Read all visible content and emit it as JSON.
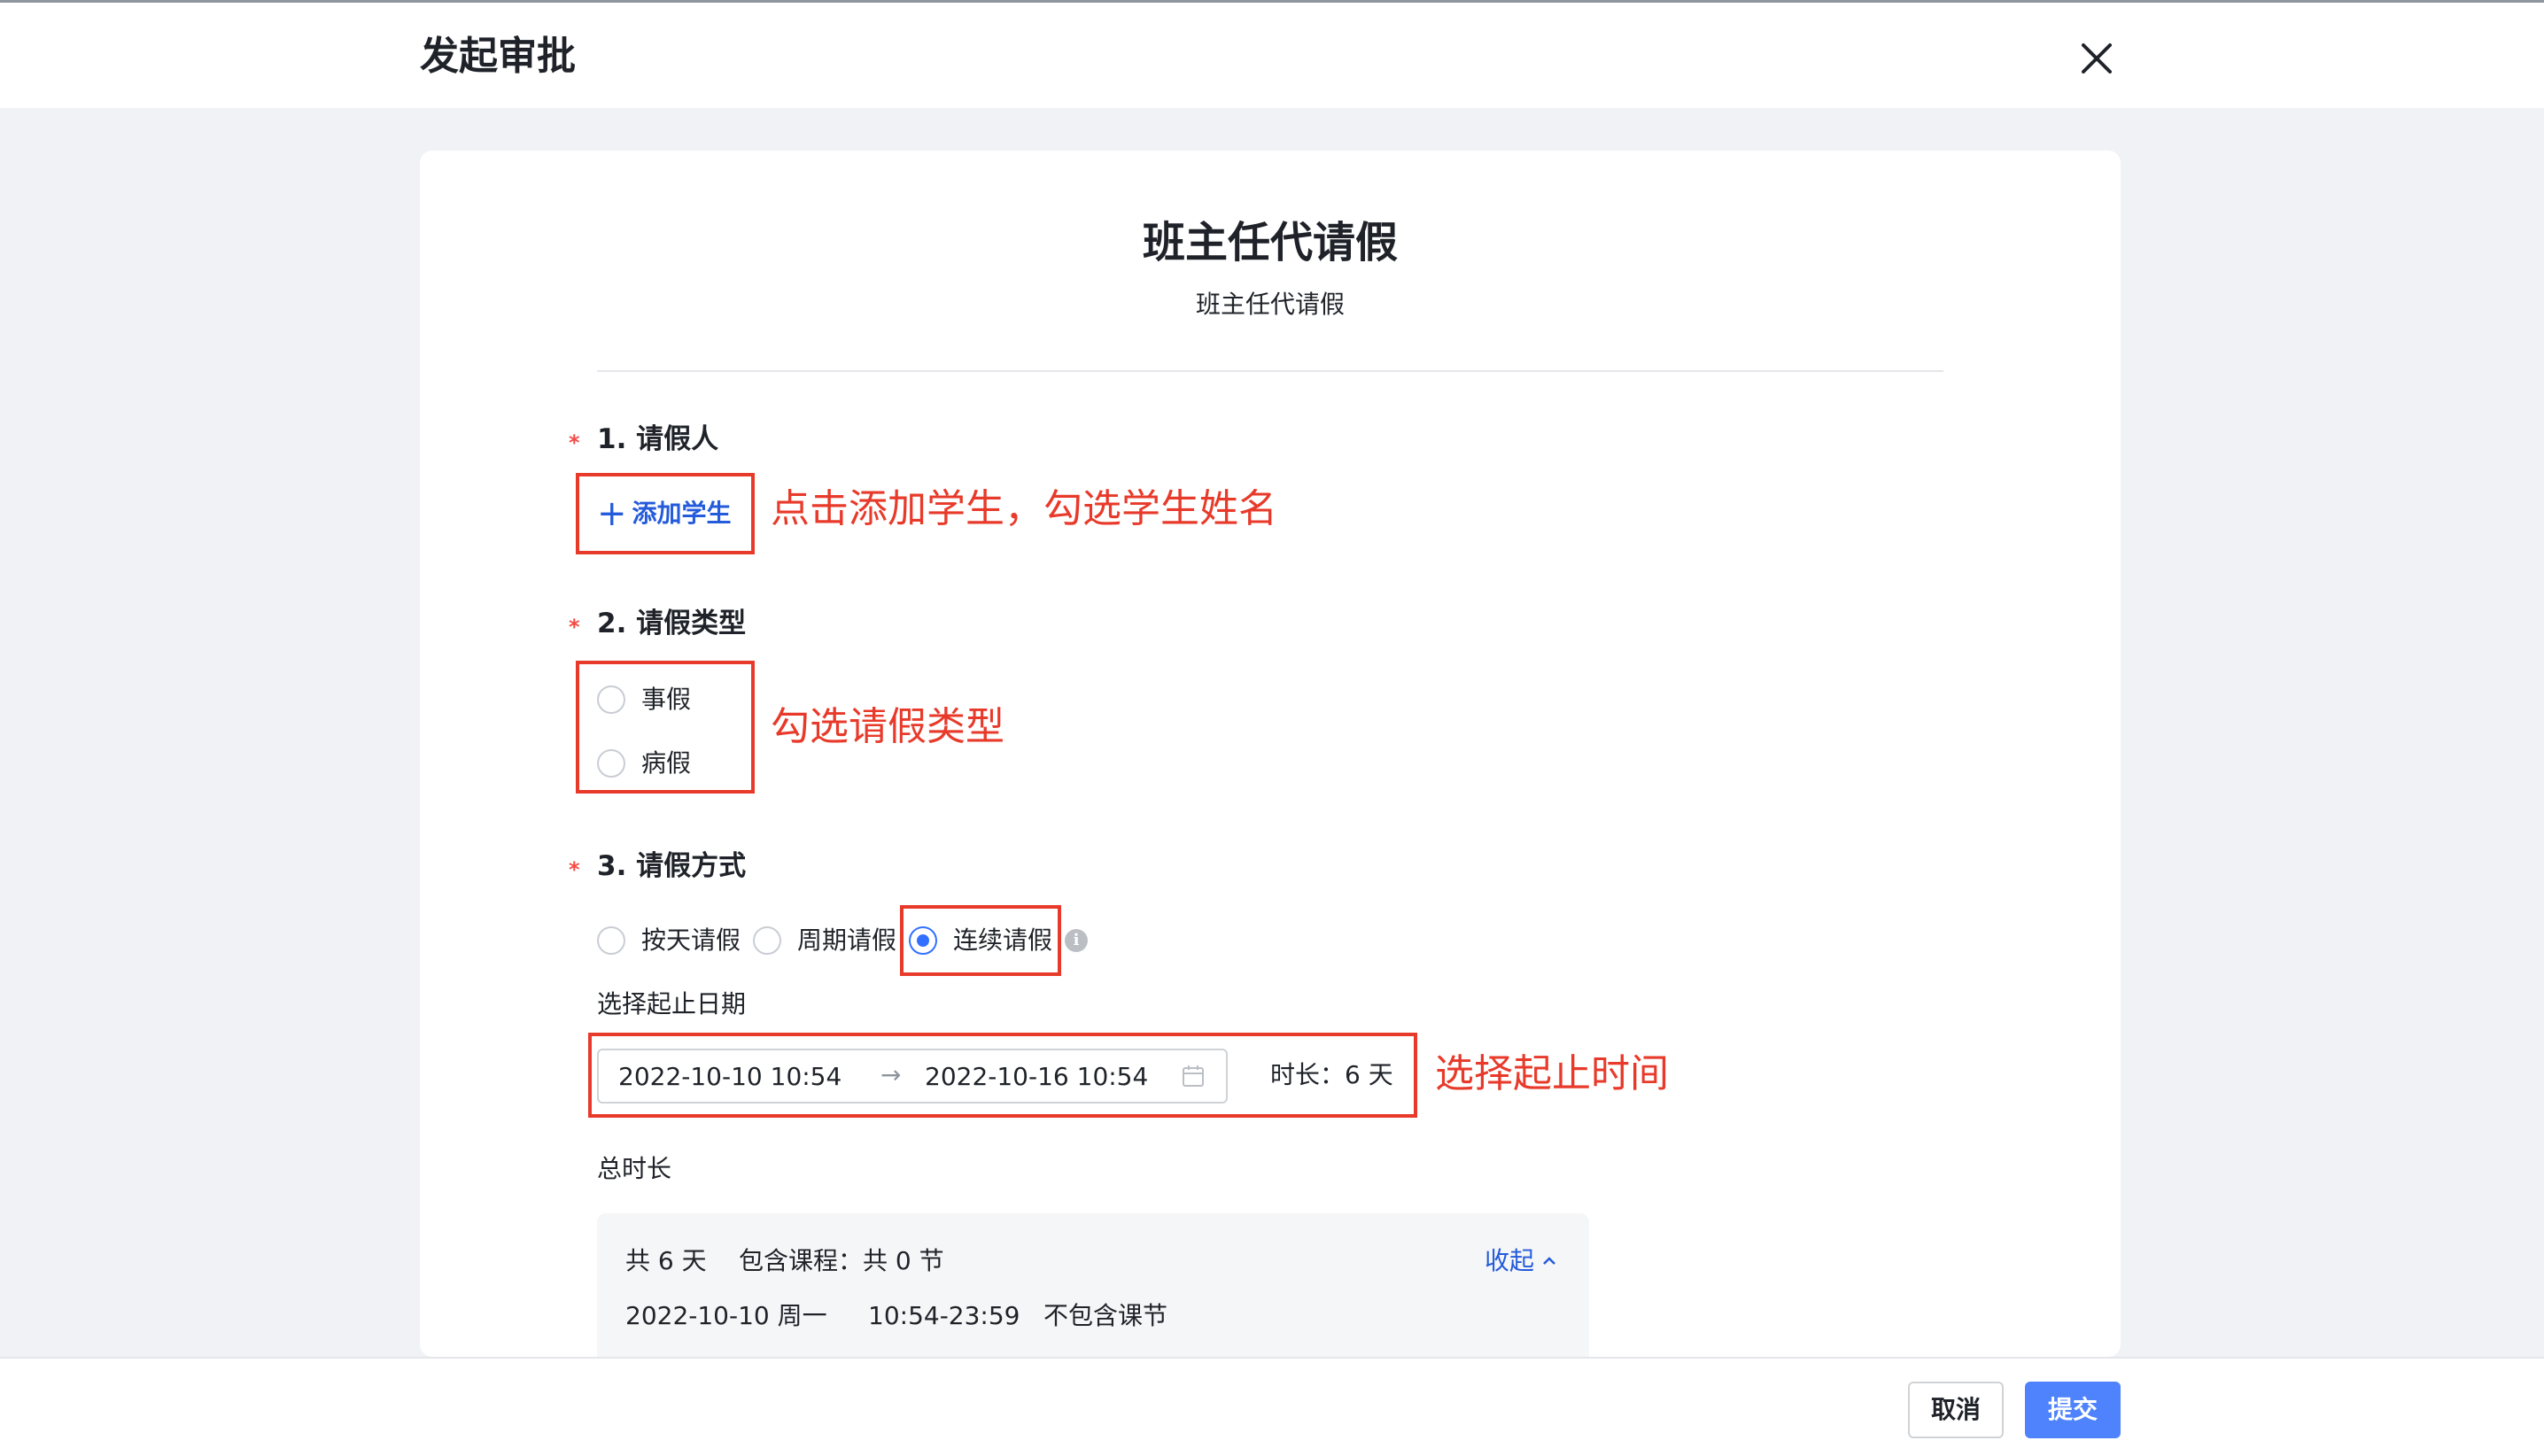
{
  "header": {
    "title": "发起审批",
    "close_icon": "close-icon"
  },
  "form": {
    "title": "班主任代请假",
    "subtitle": "班主任代请假",
    "fields": {
      "leave_person": {
        "label": "1. 请假人",
        "add_button": "添加学生"
      },
      "leave_type": {
        "label": "2. 请假类型",
        "options": [
          "事假",
          "病假"
        ]
      },
      "leave_mode": {
        "label": "3. 请假方式",
        "options": [
          "按天请假",
          "周期请假",
          "连续请假"
        ],
        "selected": "连续请假",
        "date_label": "选择起止日期",
        "start": "2022-10-10 10:54",
        "end": "2022-10-16 10:54",
        "duration": "时长：6 天",
        "total_label": "总时长"
      }
    },
    "summary": {
      "line1_days": "共 6 天",
      "line1_courses": "包含课程：共 0 节",
      "collapse": "收起",
      "row_date": "2022-10-10 周一",
      "row_time": "10:54-23:59",
      "row_note": "不包含课节"
    }
  },
  "annotations": {
    "add_student": "点击添加学生，勾选学生姓名",
    "leave_type": "勾选请假类型",
    "date_range": "选择起止时间"
  },
  "footer": {
    "cancel": "取消",
    "submit": "提交"
  },
  "colors": {
    "primary": "#3370ff",
    "annotation": "#e83a2a",
    "required": "#f54a45"
  }
}
